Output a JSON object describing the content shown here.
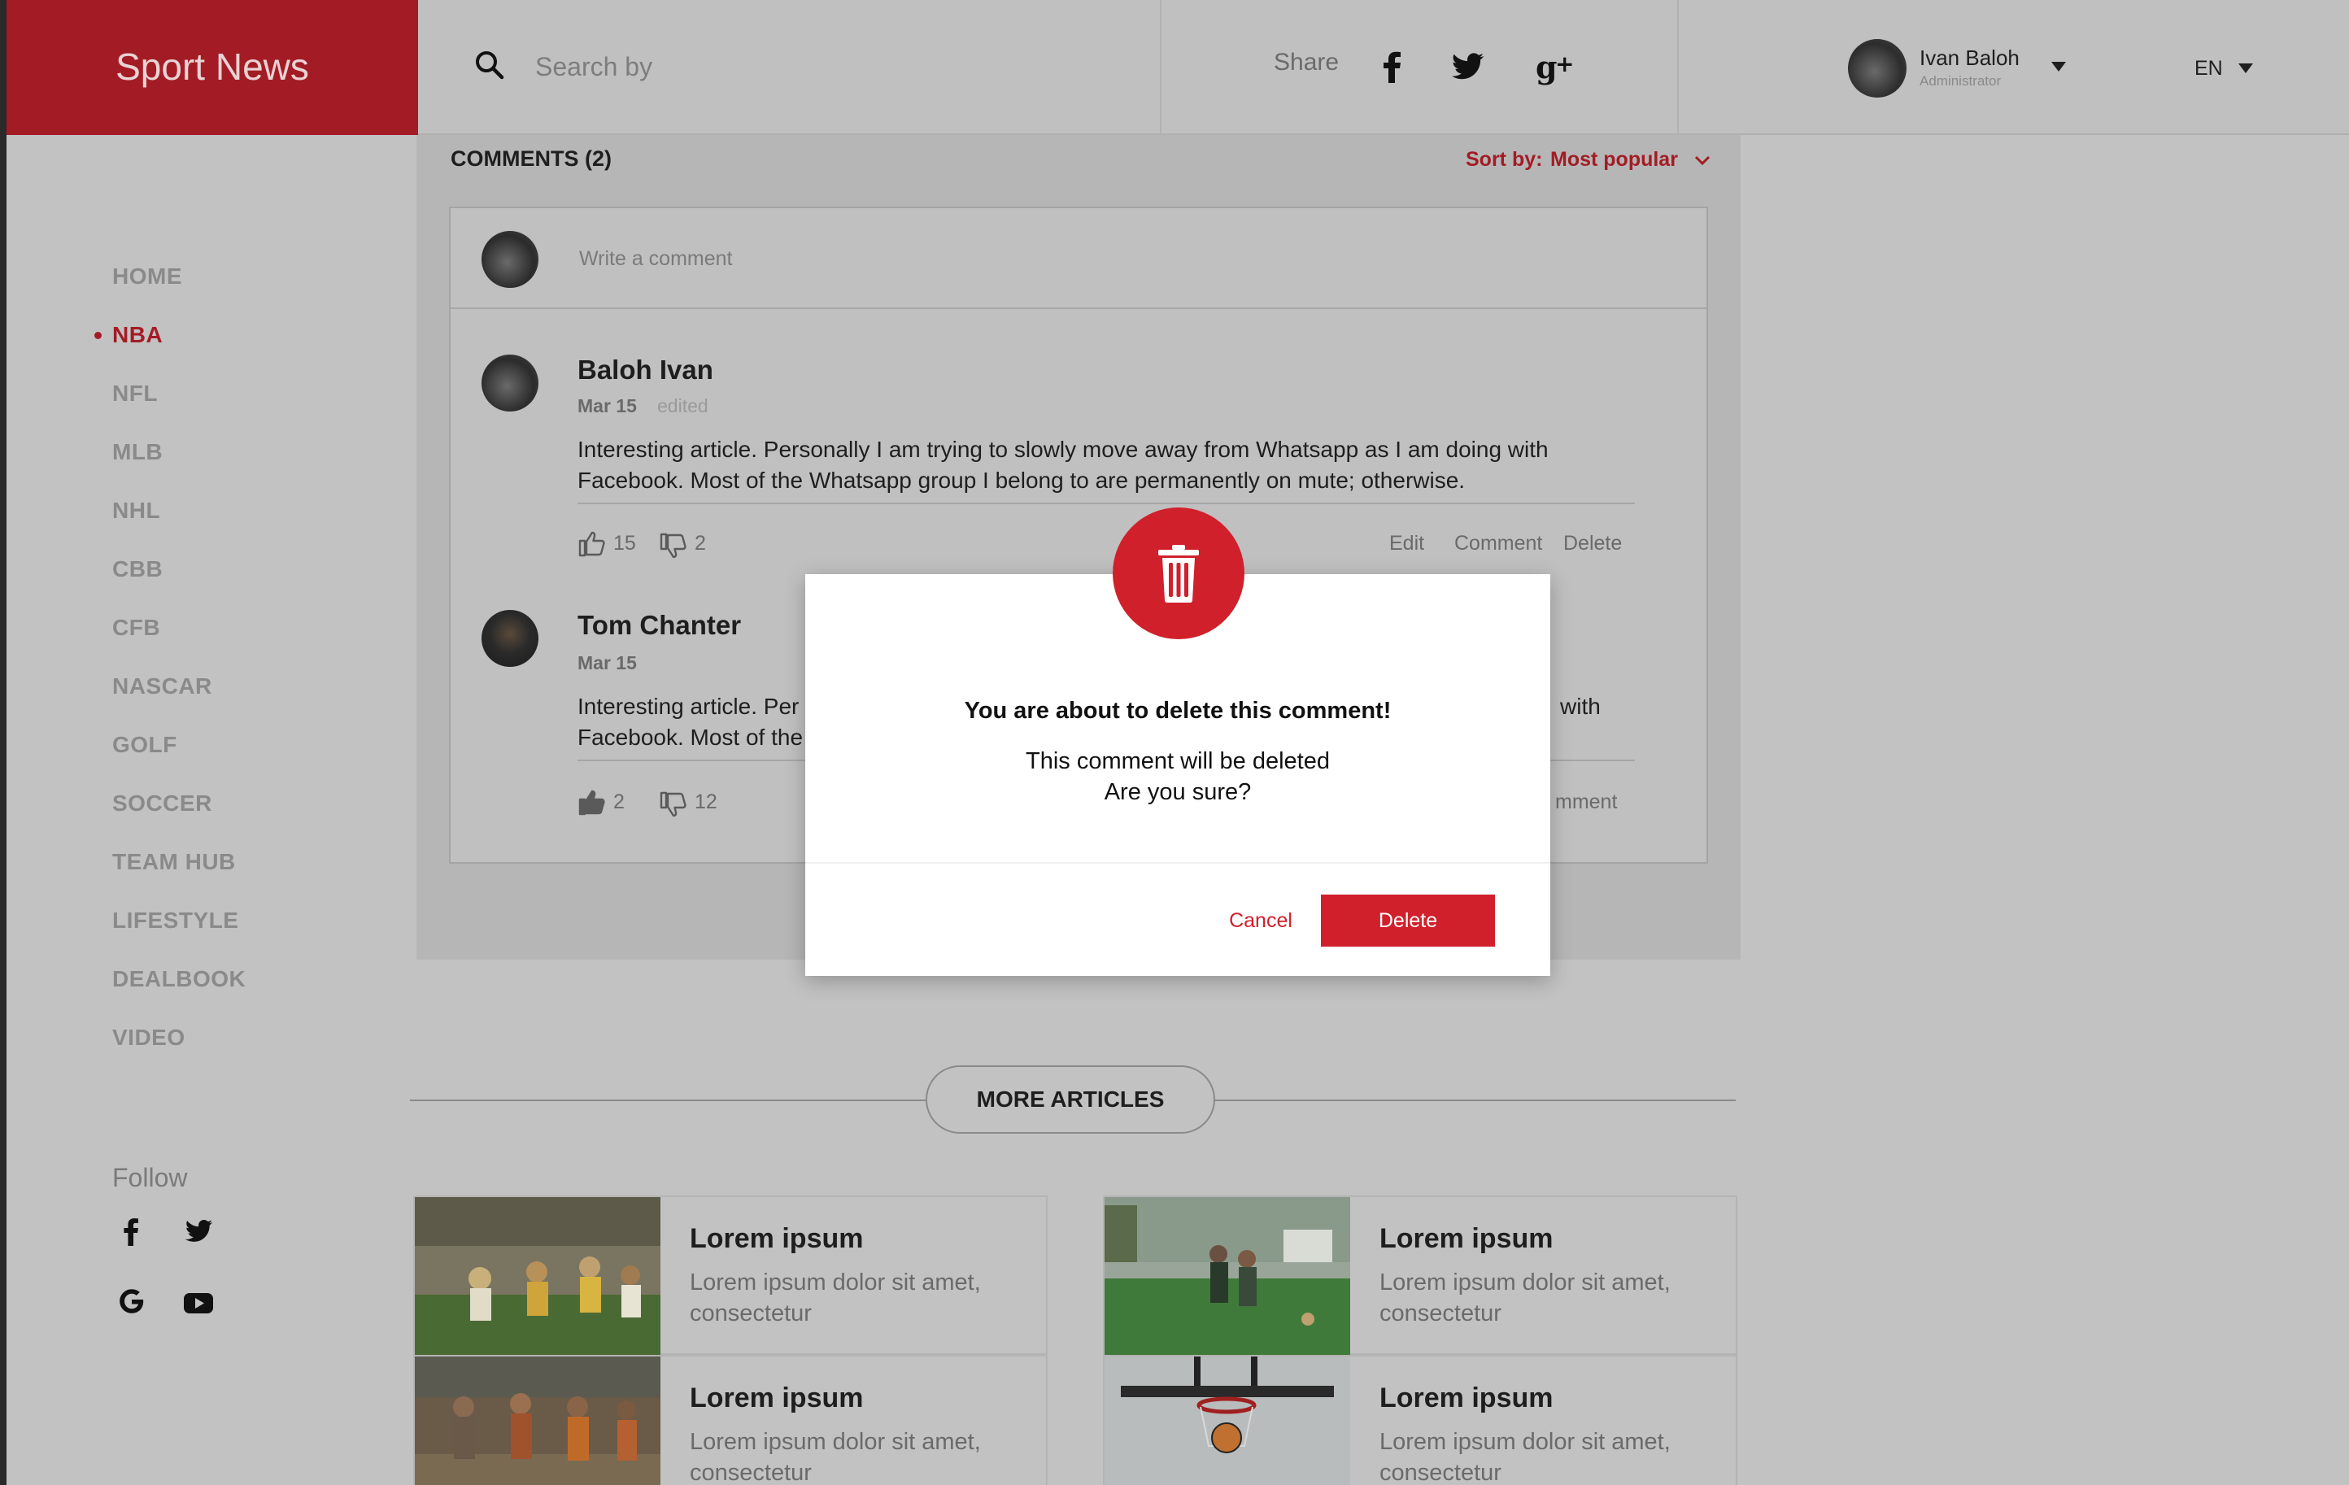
{
  "app": {
    "logo_text": "Sport News",
    "brand_color": "#a31c25",
    "accent_color": "#d0202b"
  },
  "header": {
    "search_placeholder": "Search by",
    "search_icon": "search-icon",
    "share_label": "Share",
    "share_icons": [
      "facebook-icon",
      "twitter-icon",
      "google-plus-icon"
    ],
    "user": {
      "name": "Ivan Baloh",
      "role": "Administrator"
    },
    "language": "EN"
  },
  "sidebar": {
    "items": [
      {
        "label": "HOME",
        "active": false
      },
      {
        "label": "NBA",
        "active": true
      },
      {
        "label": "NFL",
        "active": false
      },
      {
        "label": "MLB",
        "active": false
      },
      {
        "label": "NHL",
        "active": false
      },
      {
        "label": "CBB",
        "active": false
      },
      {
        "label": "CFB",
        "active": false
      },
      {
        "label": "NASCAR",
        "active": false
      },
      {
        "label": "GOLF",
        "active": false
      },
      {
        "label": "SOCCER",
        "active": false
      },
      {
        "label": "TEAM HUB",
        "active": false
      },
      {
        "label": "LIFESTYLE",
        "active": false
      },
      {
        "label": "DEALBOOK",
        "active": false
      },
      {
        "label": "VIDEO",
        "active": false
      }
    ],
    "follow_label": "Follow",
    "follow_icons": [
      "facebook-icon",
      "twitter-icon",
      "google-icon",
      "youtube-icon"
    ]
  },
  "comments": {
    "title": "COMMENTS (2)",
    "sort_label": "Sort by:",
    "sort_value": "Most popular",
    "write_placeholder": "Write a comment",
    "items": [
      {
        "author": "Baloh Ivan",
        "date": "Mar 15",
        "edited": "edited",
        "text_line1": "Interesting article. Personally I am trying to slowly move away from Whatsapp as I am doing with",
        "text_line2": "Facebook. Most of the Whatsapp group I belong to are permanently on mute; otherwise.",
        "likes": "15",
        "dislikes": "2",
        "actions": [
          "Edit",
          "Comment",
          "Delete"
        ]
      },
      {
        "author": "Tom Chanter",
        "date": "Mar 15",
        "text_line1_left": "Interesting article. Per",
        "text_line1_right": "with",
        "text_line2": "Facebook. Most of the",
        "likes": "2",
        "dislikes": "12",
        "partial_action": "mment"
      }
    ]
  },
  "more_articles": {
    "button_label": "MORE ARTICLES",
    "cards": [
      {
        "title": "Lorem ipsum",
        "desc": "Lorem ipsum dolor sit amet, consectetur"
      },
      {
        "title": "Lorem ipsum",
        "desc": "Lorem ipsum dolor sit amet, consectetur"
      },
      {
        "title": "Lorem ipsum",
        "desc": "Lorem ipsum dolor sit amet, consectetur"
      },
      {
        "title": "Lorem ipsum",
        "desc": "Lorem ipsum dolor sit amet, consectetur"
      }
    ]
  },
  "modal": {
    "icon": "trash-icon",
    "title": "You are about to delete this comment!",
    "message_line1": "This comment will be deleted",
    "message_line2": "Are you sure?",
    "cancel_label": "Cancel",
    "delete_label": "Delete"
  }
}
